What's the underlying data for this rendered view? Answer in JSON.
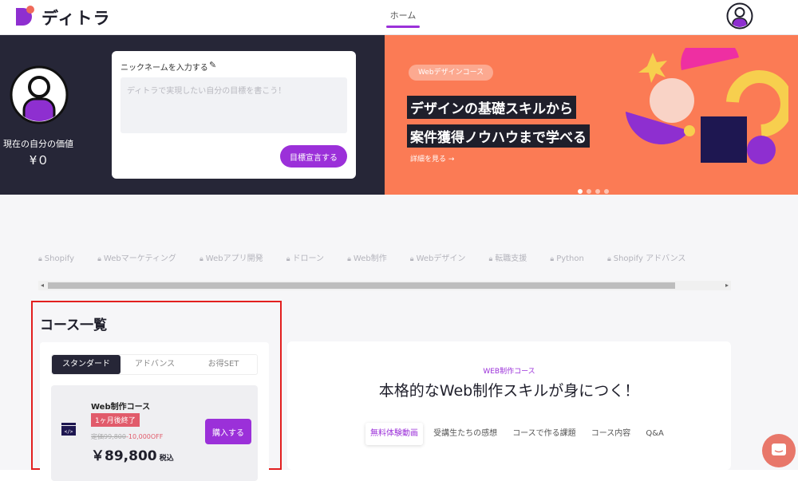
{
  "header": {
    "brand": "ディトラ",
    "nav_home": "ホーム"
  },
  "hero": {
    "worth_label": "現在の自分の価値",
    "worth_value": "¥０",
    "nickname_label": "ニックネームを入力する",
    "goal_placeholder": "ディトラで実現したい自分の目標を書こう！",
    "goal_button": "目標宣言する"
  },
  "banner": {
    "pill": "Webデザインコース",
    "headline_1": "デザインの基礎スキルから",
    "headline_2": "案件獲得ノウハウまで学べる",
    "link": "詳細を見る →",
    "slides": 4,
    "active_slide": 1,
    "bg_color": "#fb7b55"
  },
  "categories": [
    "Shopify",
    "Webマーケティング",
    "Webアプリ開発",
    "ドローン",
    "Web制作",
    "Webデザイン",
    "転職支援",
    "Python",
    "Shopify アドバンス"
  ],
  "course_list": {
    "title": "コース一覧",
    "tabs": [
      "スタンダード",
      "アドバンス",
      "お得SET"
    ],
    "active_tab": 0,
    "course": {
      "name": "Web制作コース",
      "badge": "1ヶ月後終了",
      "price_list": "定価99,800",
      "price_discount": "-10,000OFF",
      "price": "￥89,800",
      "tax": "税込",
      "buy_button": "購入する"
    }
  },
  "course_detail": {
    "eyebrow": "WEB制作コース",
    "title": "本格的なWeb制作スキルが身につく！",
    "tabs": [
      "無料体験動画",
      "受講生たちの感想",
      "コースで作る課題",
      "コース内容",
      "Q&A"
    ],
    "active_tab": 0
  },
  "colors": {
    "accent": "#9b30d9",
    "dark": "#262637",
    "highlight": "#e21f1f"
  }
}
